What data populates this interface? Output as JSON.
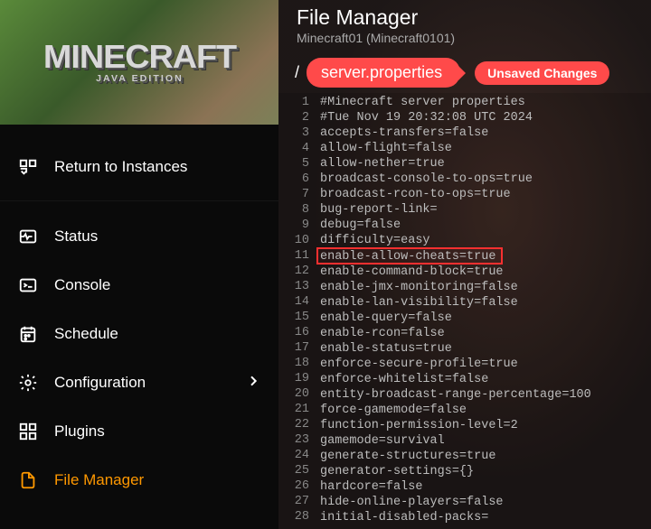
{
  "logo": {
    "title": "MINECRAFT",
    "subtitle": "JAVA EDITION"
  },
  "sidebar": {
    "return": "Return to Instances",
    "items": [
      {
        "label": "Status"
      },
      {
        "label": "Console"
      },
      {
        "label": "Schedule"
      },
      {
        "label": "Configuration"
      },
      {
        "label": "Plugins"
      },
      {
        "label": "File Manager"
      }
    ]
  },
  "header": {
    "title": "File Manager",
    "subtitle": "Minecraft01 (Minecraft0101)"
  },
  "breadcrumb": {
    "root": "/",
    "file": "server.properties",
    "unsaved": "Unsaved Changes"
  },
  "editor": {
    "highlight_line": 11,
    "lines": [
      "#Minecraft server properties",
      "#Tue Nov 19 20:32:08 UTC 2024",
      "accepts-transfers=false",
      "allow-flight=false",
      "allow-nether=true",
      "broadcast-console-to-ops=true",
      "broadcast-rcon-to-ops=true",
      "bug-report-link=",
      "debug=false",
      "difficulty=easy",
      "enable-allow-cheats=true",
      "enable-command-block=true",
      "enable-jmx-monitoring=false",
      "enable-lan-visibility=false",
      "enable-query=false",
      "enable-rcon=false",
      "enable-status=true",
      "enforce-secure-profile=true",
      "enforce-whitelist=false",
      "entity-broadcast-range-percentage=100",
      "force-gamemode=false",
      "function-permission-level=2",
      "gamemode=survival",
      "generate-structures=true",
      "generator-settings={}",
      "hardcore=false",
      "hide-online-players=false",
      "initial-disabled-packs="
    ]
  }
}
